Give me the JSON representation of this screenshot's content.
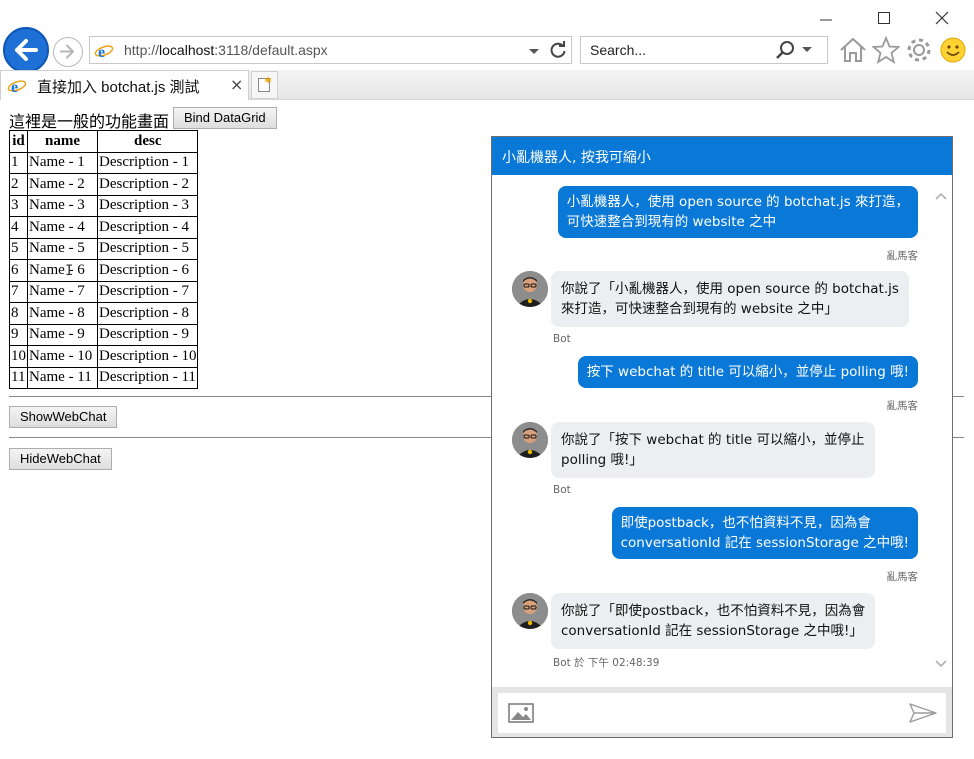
{
  "browser": {
    "url_prefix": "http://",
    "url_host": "localhost",
    "url_rest": ":3118/default.aspx",
    "search_placeholder": "Search...",
    "tab_title": "直接加入 botchat.js 測試",
    "tab_close": "×",
    "icons": [
      "back-arrow-icon",
      "forward-arrow-icon",
      "ie-logo-icon",
      "dropdown-icon",
      "refresh-icon",
      "search-icon",
      "home-icon",
      "star-icon",
      "gear-icon",
      "smiley-icon",
      "new-tab-icon",
      "minimize-icon",
      "maximize-icon",
      "close-icon"
    ]
  },
  "page": {
    "intro": "這裡是一般的功能畫面",
    "bind_button": "Bind DataGrid",
    "show_button": "ShowWebChat",
    "hide_button": "HideWebChat",
    "grid": {
      "headers": [
        "id",
        "name",
        "desc"
      ],
      "rows": [
        [
          "1",
          "Name - 1",
          "Description - 1"
        ],
        [
          "2",
          "Name - 2",
          "Description - 2"
        ],
        [
          "3",
          "Name - 3",
          "Description - 3"
        ],
        [
          "4",
          "Name - 4",
          "Description - 4"
        ],
        [
          "5",
          "Name - 5",
          "Description - 5"
        ],
        [
          "6",
          "Name - 6",
          "Description - 6"
        ],
        [
          "7",
          "Name - 7",
          "Description - 7"
        ],
        [
          "8",
          "Name - 8",
          "Description - 8"
        ],
        [
          "9",
          "Name - 9",
          "Description - 9"
        ],
        [
          "10",
          "Name - 10",
          "Description - 10"
        ],
        [
          "11",
          "Name - 11",
          "Description - 11"
        ]
      ]
    }
  },
  "chat": {
    "title": "小亂機器人, 按我可縮小",
    "accent": "#0a78d7",
    "messages": [
      {
        "from": "user",
        "lines": [
          "小亂機器人，使用 open source 的 botchat.js 來打造，",
          "可快速整合到現有的 website 之中"
        ],
        "sender": "亂馬客"
      },
      {
        "from": "bot",
        "lines": [
          "你說了「小亂機器人，使用 open source 的 botchat.js",
          "來打造，可快速整合到現有的 website 之中」"
        ],
        "sender": "Bot"
      },
      {
        "from": "user",
        "lines": [
          "按下 webchat 的 title 可以縮小，並停止 polling 哦!"
        ],
        "sender": "亂馬客"
      },
      {
        "from": "bot",
        "lines": [
          "你說了「按下 webchat 的 title 可以縮小，並停止",
          "polling 哦!」"
        ],
        "sender": "Bot"
      },
      {
        "from": "user",
        "lines": [
          "即使postback，也不怕資料不見，因為會",
          "conversationId 記在 sessionStorage 之中哦!"
        ],
        "sender": "亂馬客"
      },
      {
        "from": "bot",
        "lines": [
          "你說了「即使postback，也不怕資料不見，因為會",
          "conversationId 記在 sessionStorage 之中哦!」"
        ],
        "sender": "Bot 於 下午 02:48:39"
      }
    ]
  }
}
